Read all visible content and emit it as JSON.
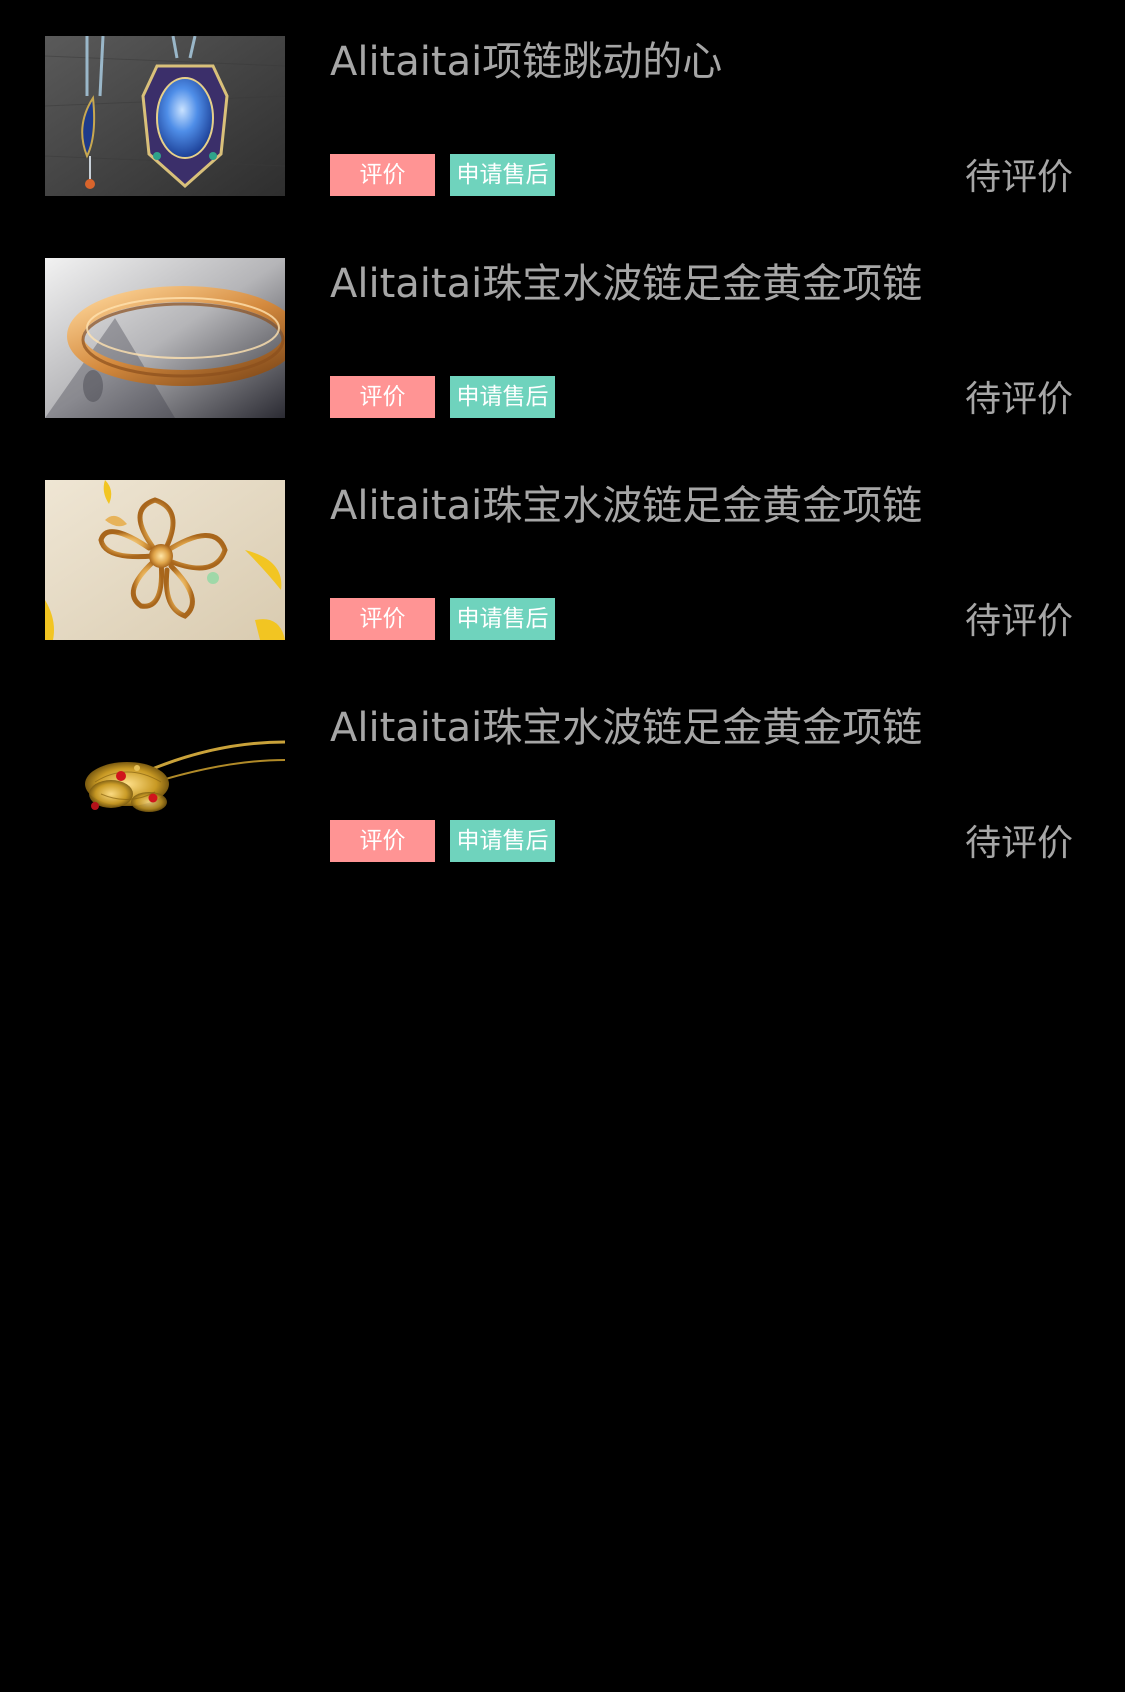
{
  "colors": {
    "background": "#000000",
    "text": "#a6a6a6",
    "review_button": "#ff9494",
    "aftersale_button": "#6fd3bd"
  },
  "orders": [
    {
      "title": "Alitaitai项链跳动的心",
      "review_label": "评价",
      "aftersale_label": "申请售后",
      "status": "待评价",
      "image": "blue-moonstone-pendant-necklace"
    },
    {
      "title": "Alitaitai珠宝水波链足金黄金项链",
      "review_label": "评价",
      "aftersale_label": "申请售后",
      "status": "待评价",
      "image": "gold-bangle"
    },
    {
      "title": "Alitaitai珠宝水波链足金黄金项链",
      "review_label": "评价",
      "aftersale_label": "申请售后",
      "status": "待评价",
      "image": "gold-flower-brooch"
    },
    {
      "title": "Alitaitai珠宝水波链足金黄金项链",
      "review_label": "评价",
      "aftersale_label": "申请售后",
      "status": "待评价",
      "image": "gold-hairpin-with-red-gems"
    }
  ]
}
